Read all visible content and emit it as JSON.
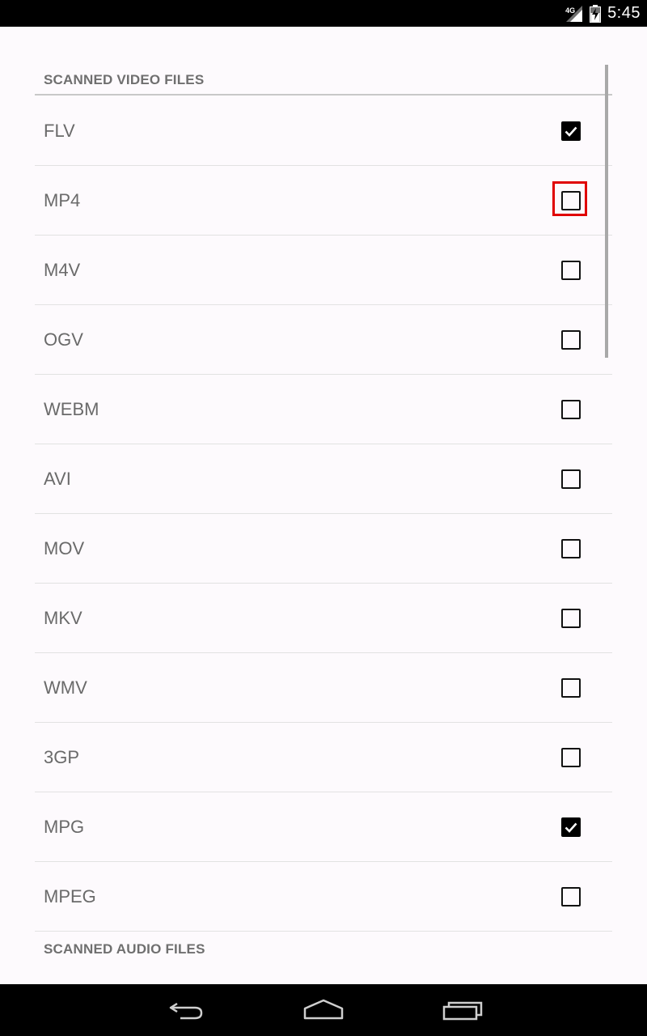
{
  "status_bar": {
    "network_label": "4G",
    "time": "5:45"
  },
  "sections": {
    "video_header": "SCANNED VIDEO FILES",
    "audio_header": "SCANNED AUDIO FILES"
  },
  "video_formats": [
    {
      "label": "FLV",
      "checked": true
    },
    {
      "label": "MP4",
      "checked": false,
      "highlighted": true
    },
    {
      "label": "M4V",
      "checked": false
    },
    {
      "label": "OGV",
      "checked": false
    },
    {
      "label": "WEBM",
      "checked": false
    },
    {
      "label": "AVI",
      "checked": false
    },
    {
      "label": "MOV",
      "checked": false
    },
    {
      "label": "MKV",
      "checked": false
    },
    {
      "label": "WMV",
      "checked": false
    },
    {
      "label": "3GP",
      "checked": false
    },
    {
      "label": "MPG",
      "checked": true
    },
    {
      "label": "MPEG",
      "checked": false
    }
  ],
  "colors": {
    "highlight": "#e00000",
    "label_text": "#6a6a6a",
    "background": "#fdfafd"
  },
  "nav_icons": [
    "back-icon",
    "home-icon",
    "recent-apps-icon"
  ]
}
